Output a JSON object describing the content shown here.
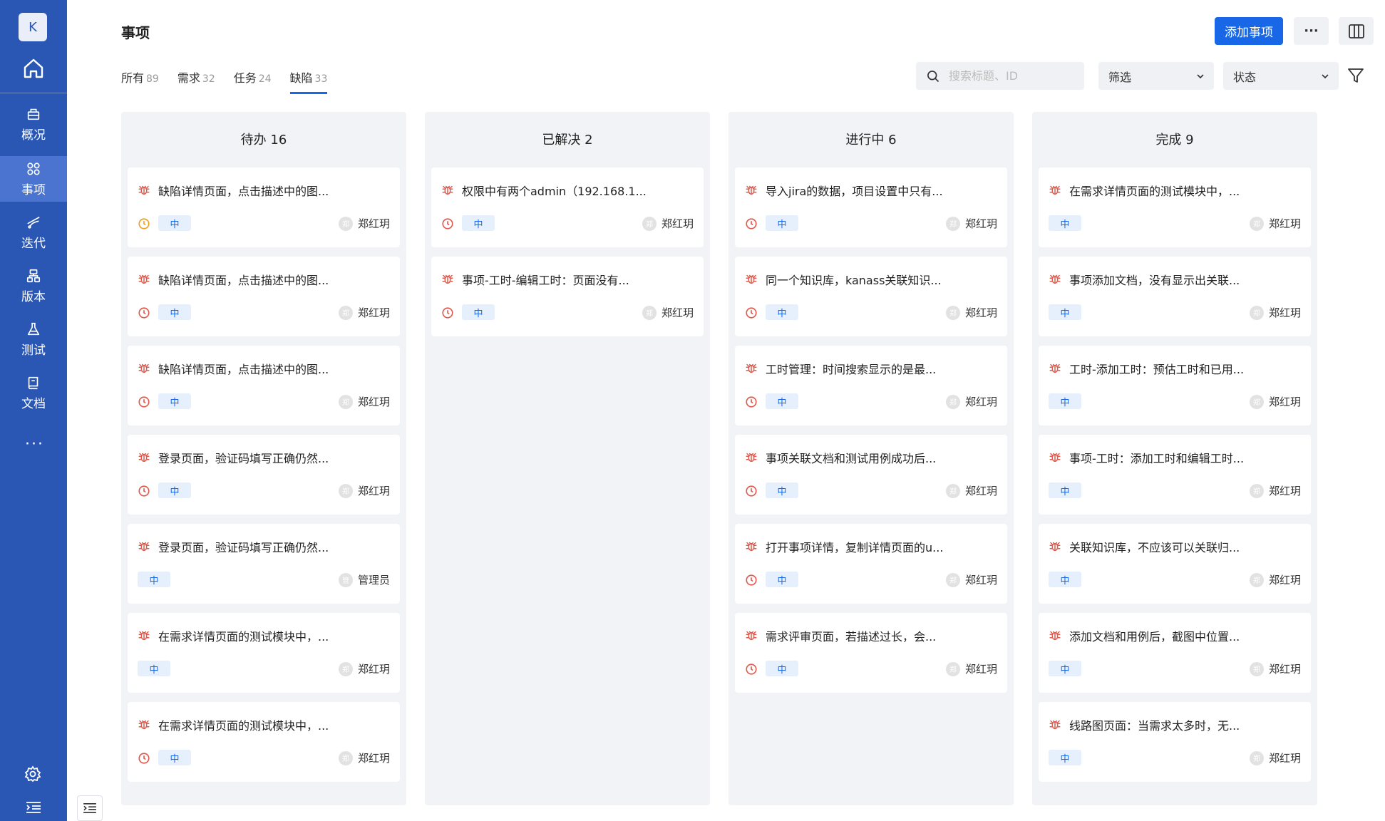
{
  "sidebar": {
    "avatar": "K",
    "items": [
      {
        "label": "概况",
        "icon": "overview-icon"
      },
      {
        "label": "事项",
        "icon": "issues-icon",
        "active": true
      },
      {
        "label": "迭代",
        "icon": "sprint-icon"
      },
      {
        "label": "版本",
        "icon": "version-icon"
      },
      {
        "label": "测试",
        "icon": "test-icon"
      },
      {
        "label": "文档",
        "icon": "document-icon"
      }
    ],
    "more": "···"
  },
  "header": {
    "title": "事项",
    "add_label": "添加事项",
    "more_label": "···"
  },
  "tabs": [
    {
      "label": "所有",
      "count": "89"
    },
    {
      "label": "需求",
      "count": "32"
    },
    {
      "label": "任务",
      "count": "24"
    },
    {
      "label": "缺陷",
      "count": "33",
      "active": true
    }
  ],
  "search": {
    "placeholder": "搜索标题、ID"
  },
  "filter": {
    "label": "筛选"
  },
  "status": {
    "label": "状态"
  },
  "colors": {
    "sidebar": "#2a56b4",
    "primary": "#1867e6",
    "bug": "#e05a4e",
    "clock_red": "#e05a4e",
    "clock_orange": "#f0a020"
  },
  "columns": [
    {
      "title": "待办 16",
      "cards": [
        {
          "title": "缺陷详情页面，点击描述中的图...",
          "clock": "orange",
          "priority": "中",
          "assignee": "郑红玥",
          "avatar_char": "郑"
        },
        {
          "title": "缺陷详情页面，点击描述中的图...",
          "clock": "red",
          "priority": "中",
          "assignee": "郑红玥",
          "avatar_char": "郑"
        },
        {
          "title": "缺陷详情页面，点击描述中的图...",
          "clock": "red",
          "priority": "中",
          "assignee": "郑红玥",
          "avatar_char": "郑"
        },
        {
          "title": "登录页面，验证码填写正确仍然...",
          "clock": "red",
          "priority": "中",
          "assignee": "郑红玥",
          "avatar_char": "郑"
        },
        {
          "title": "登录页面，验证码填写正确仍然...",
          "clock": "",
          "priority": "中",
          "assignee": "管理员",
          "avatar_char": "管"
        },
        {
          "title": "在需求详情页面的测试模块中，...",
          "clock": "",
          "priority": "中",
          "assignee": "郑红玥",
          "avatar_char": "郑"
        },
        {
          "title": "在需求详情页面的测试模块中，...",
          "clock": "red",
          "priority": "中",
          "assignee": "郑红玥",
          "avatar_char": "郑"
        }
      ]
    },
    {
      "title": "已解决 2",
      "cards": [
        {
          "title": "权限中有两个admin（192.168.1...",
          "clock": "red",
          "priority": "中",
          "assignee": "郑红玥",
          "avatar_char": "郑"
        },
        {
          "title": "事项-工时-编辑工时：页面没有...",
          "clock": "red",
          "priority": "中",
          "assignee": "郑红玥",
          "avatar_char": "郑"
        }
      ]
    },
    {
      "title": "进行中 6",
      "cards": [
        {
          "title": "导入jira的数据，项目设置中只有...",
          "clock": "red",
          "priority": "中",
          "assignee": "郑红玥",
          "avatar_char": "郑"
        },
        {
          "title": "同一个知识库，kanass关联知识...",
          "clock": "red",
          "priority": "中",
          "assignee": "郑红玥",
          "avatar_char": "郑"
        },
        {
          "title": "工时管理：时间搜索显示的是最...",
          "clock": "red",
          "priority": "中",
          "assignee": "郑红玥",
          "avatar_char": "郑"
        },
        {
          "title": "事项关联文档和测试用例成功后...",
          "clock": "red",
          "priority": "中",
          "assignee": "郑红玥",
          "avatar_char": "郑"
        },
        {
          "title": "打开事项详情，复制详情页面的u...",
          "clock": "red",
          "priority": "中",
          "assignee": "郑红玥",
          "avatar_char": "郑"
        },
        {
          "title": "需求评审页面，若描述过长，会...",
          "clock": "red",
          "priority": "中",
          "assignee": "郑红玥",
          "avatar_char": "郑"
        }
      ]
    },
    {
      "title": "完成 9",
      "cards": [
        {
          "title": "在需求详情页面的测试模块中，...",
          "clock": "",
          "priority": "中",
          "assignee": "郑红玥",
          "avatar_char": "郑"
        },
        {
          "title": "事项添加文档，没有显示出关联...",
          "clock": "",
          "priority": "中",
          "assignee": "郑红玥",
          "avatar_char": "郑"
        },
        {
          "title": "工时-添加工时：预估工时和已用...",
          "clock": "",
          "priority": "中",
          "assignee": "郑红玥",
          "avatar_char": "郑"
        },
        {
          "title": "事项-工时：添加工时和编辑工时...",
          "clock": "",
          "priority": "中",
          "assignee": "郑红玥",
          "avatar_char": "郑"
        },
        {
          "title": "关联知识库，不应该可以关联归...",
          "clock": "",
          "priority": "中",
          "assignee": "郑红玥",
          "avatar_char": "郑"
        },
        {
          "title": "添加文档和用例后，截图中位置...",
          "clock": "",
          "priority": "中",
          "assignee": "郑红玥",
          "avatar_char": "郑"
        },
        {
          "title": "线路图页面：当需求太多时，无...",
          "clock": "",
          "priority": "中",
          "assignee": "郑红玥",
          "avatar_char": "郑"
        }
      ]
    }
  ]
}
